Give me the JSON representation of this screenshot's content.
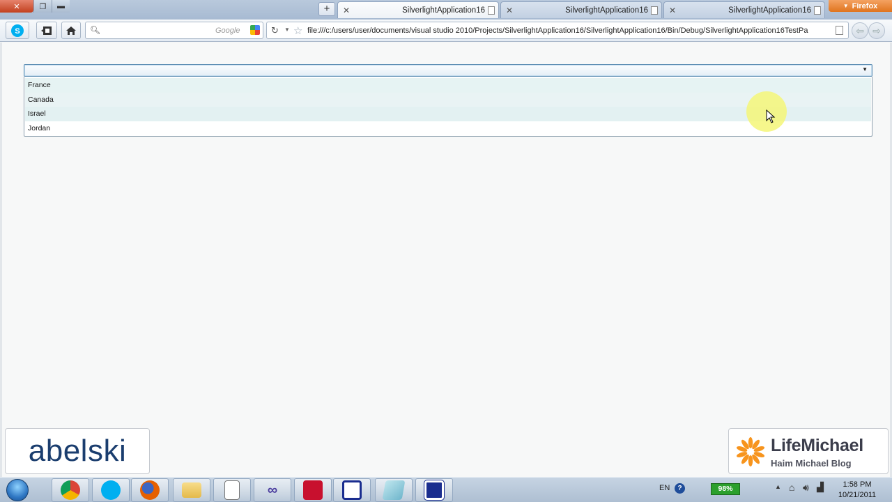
{
  "browser": {
    "tabs": [
      {
        "label": "SilverlightApplication16"
      },
      {
        "label": "SilverlightApplication16"
      },
      {
        "label": "SilverlightApplication16"
      }
    ],
    "firefox_menu_label": "Firefox",
    "search_placeholder": "Google",
    "url": "file:///c:/users/user/documents/visual studio 2010/Projects/SilverlightApplication16/SilverlightApplication16/Bin/Debug/SilverlightApplication16TestPa"
  },
  "combobox": {
    "selected": "",
    "items": [
      "France",
      "Canada",
      "Israel",
      "Jordan"
    ]
  },
  "watermarks": {
    "abelski": "abelski",
    "lifemichael_title": "LifeMichael",
    "lifemichael_subtitle": "Haim Michael Blog"
  },
  "taskbar": {
    "language": "EN",
    "battery": "98%",
    "time": "1:58 PM",
    "date": "10/21/2011"
  },
  "colors": {
    "accent_orange": "#e0741e",
    "combo_border": "#5f8fb4",
    "battery_green": "#2ca02c"
  }
}
